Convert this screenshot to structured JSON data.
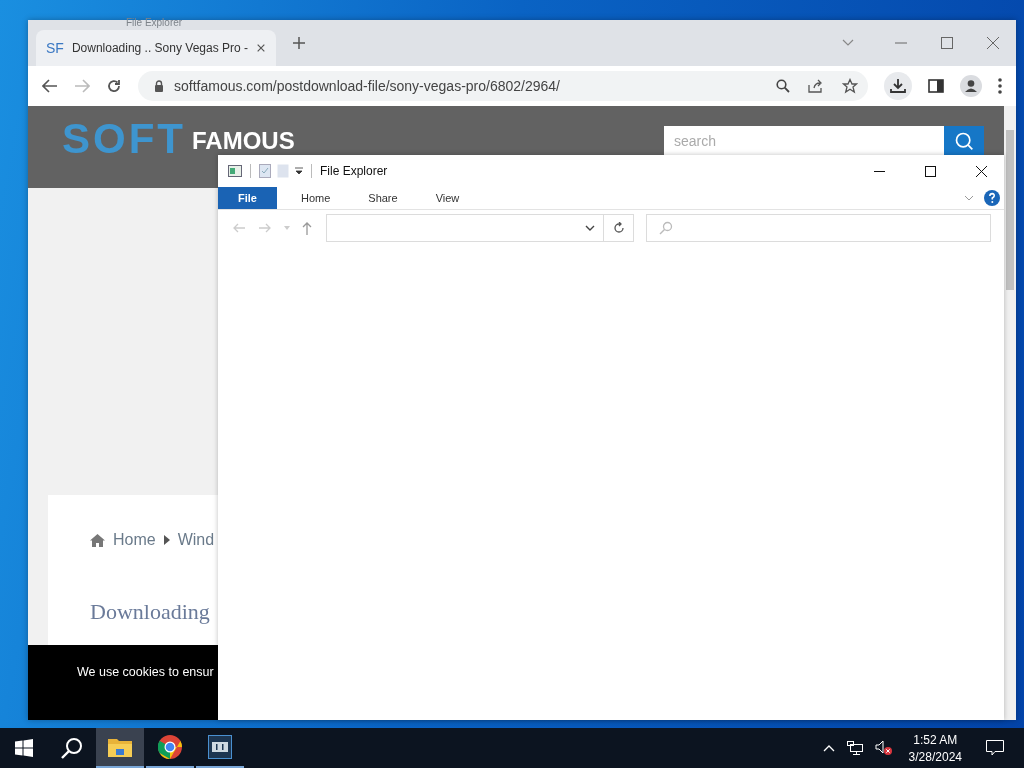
{
  "ghost_window": {
    "title": "File Explorer"
  },
  "browser": {
    "tab": {
      "favicon": "SF",
      "title": "Downloading .. Sony Vegas Pro -"
    },
    "url": "softfamous.com/postdownload-file/sony-vegas-pro/6802/2964/",
    "page": {
      "logo": [
        "SOFT",
        "FAMOUS"
      ],
      "search_placeholder": "search",
      "breadcrumb": [
        "Home",
        "Wind"
      ],
      "heading": "Downloading",
      "cookie_text": "We use cookies to ensur"
    }
  },
  "explorer": {
    "title": "File Explorer",
    "ribbon_tabs": [
      {
        "label": "File",
        "selected": true
      },
      {
        "label": "Home",
        "selected": false
      },
      {
        "label": "Share",
        "selected": false
      },
      {
        "label": "View",
        "selected": false
      }
    ]
  },
  "taskbar": {
    "apps": [
      {
        "kind": "explorer",
        "active": true
      },
      {
        "kind": "chrome",
        "active": false
      },
      {
        "kind": "video",
        "active": false
      }
    ],
    "time": "1:52 AM",
    "date": "3/28/2024",
    "volume_muted": true
  }
}
